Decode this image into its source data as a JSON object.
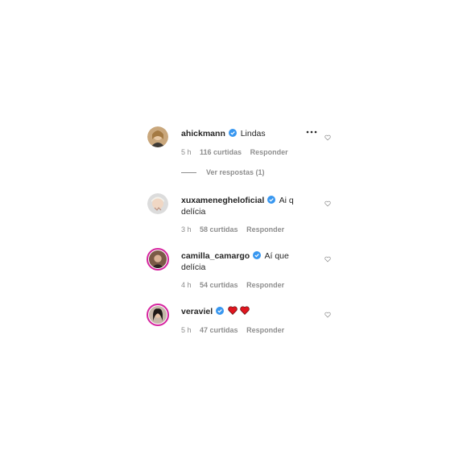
{
  "comments": [
    {
      "username": "ahickmann",
      "text": "Lindas",
      "time": "5 h",
      "likes": "116 curtidas",
      "reply": "Responder"
    },
    {
      "username": "xuxameneghelоficial",
      "text": "Ai q delícia",
      "time": "3 h",
      "likes": "58 curtidas",
      "reply": "Responder"
    },
    {
      "username": "camilla_camargo",
      "text": "Aí que delícia",
      "time": "4 h",
      "likes": "54 curtidas",
      "reply": "Responder"
    },
    {
      "username": "veraviel",
      "text": "",
      "time": "5 h",
      "likes": "47 curtidas",
      "reply": "Responder"
    }
  ],
  "view_replies": "Ver respostas (1)",
  "colors": {
    "verified": "#3897f0",
    "meta": "#8e8e8e",
    "text": "#262626",
    "heart_emoji": "#e0151f",
    "story_ring": "#d6249f"
  },
  "icons": {
    "more": "more-options-icon",
    "verified": "verified-badge-icon",
    "like": "heart-outline-icon",
    "emoji": "red-heart-emoji"
  }
}
